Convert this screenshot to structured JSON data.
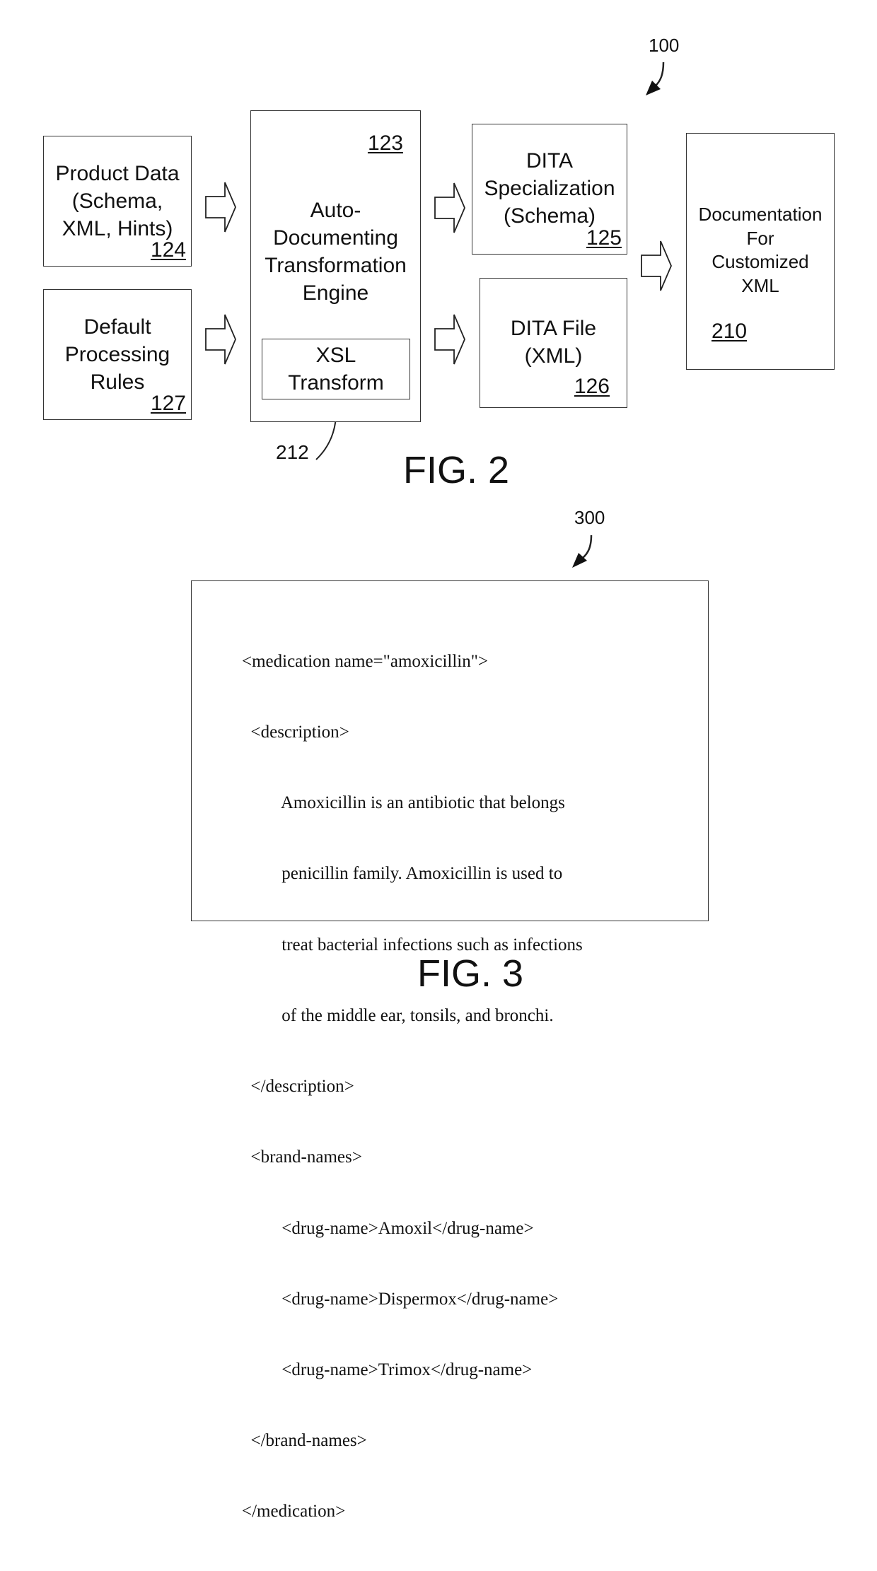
{
  "fig2": {
    "caption": "FIG. 2",
    "system_ref": "100",
    "boxes": {
      "product_data": {
        "label": "Product Data\n(Schema,\nXML, Hints)",
        "ref": "124"
      },
      "default_rules": {
        "label": "Default\nProcessing\nRules",
        "ref": "127"
      },
      "engine": {
        "label": "Auto-\nDocumenting\nTransformation\nEngine",
        "ref": "123"
      },
      "xsl": {
        "label": "XSL\nTransform",
        "ref": "212"
      },
      "dita_spec": {
        "label": "DITA\nSpecialization\n(Schema)",
        "ref": "125"
      },
      "dita_file": {
        "label": "DITA File\n(XML)",
        "ref": "126"
      },
      "documentation": {
        "label": "Documentation\nFor\nCustomized\nXML",
        "ref": "210"
      }
    }
  },
  "fig3": {
    "caption": "FIG. 3",
    "ref": "300",
    "code_lines": [
      "<medication name=\"amoxicillin\">",
      "  <description>",
      "         Amoxicillin is an antibiotic that belongs",
      "         penicillin family. Amoxicillin is used to",
      "         treat bacterial infections such as infections",
      "         of the middle ear, tonsils, and bronchi.",
      "  </description>",
      "  <brand-names>",
      "         <drug-name>Amoxil</drug-name>",
      "         <drug-name>Dispermox</drug-name>",
      "         <drug-name>Trimox</drug-name>",
      "  </brand-names>",
      "</medication>"
    ]
  }
}
